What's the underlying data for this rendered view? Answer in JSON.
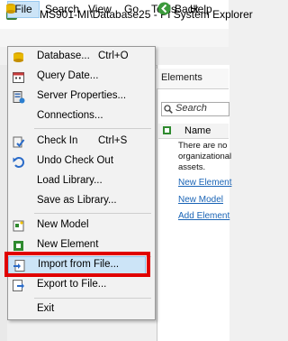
{
  "window": {
    "title": "\\\\PIMS901-MI\\Database25 - PI System Explorer"
  },
  "menubar": {
    "items": [
      "File",
      "Search",
      "View",
      "Go",
      "Tools",
      "Help"
    ]
  },
  "toolbar": {
    "back_label": "Back"
  },
  "elements_panel": {
    "title": "Elements",
    "search_placeholder": "Search",
    "column_name": "Name",
    "empty_message": "There are no organizational assets.",
    "links": [
      "New Element",
      "New Model",
      "Add Element"
    ]
  },
  "file_menu": {
    "items": [
      {
        "label": "Database...",
        "shortcut": "Ctrl+O",
        "icon": "database-icon"
      },
      {
        "label": "Query Date...",
        "shortcut": "",
        "icon": "calendar-icon"
      },
      {
        "label": "Server Properties...",
        "shortcut": "",
        "icon": "server-properties-icon"
      },
      {
        "label": "Connections...",
        "shortcut": "",
        "icon": ""
      },
      {
        "label": "Check In",
        "shortcut": "Ctrl+S",
        "icon": "check-in-icon"
      },
      {
        "label": "Undo Check Out",
        "shortcut": "",
        "icon": "undo-icon"
      },
      {
        "label": "Load Library...",
        "shortcut": "",
        "icon": ""
      },
      {
        "label": "Save as Library...",
        "shortcut": "",
        "icon": ""
      },
      {
        "label": "New Model",
        "shortcut": "",
        "icon": "new-model-icon"
      },
      {
        "label": "New Element",
        "shortcut": "",
        "icon": "new-element-icon"
      },
      {
        "label": "Import from File...",
        "shortcut": "",
        "icon": "import-icon"
      },
      {
        "label": "Export to File...",
        "shortcut": "",
        "icon": "export-icon"
      },
      {
        "label": "Exit",
        "shortcut": "",
        "icon": ""
      }
    ],
    "highlighted_item": "Import from File..."
  },
  "colors": {
    "highlight_border": "#e00000",
    "menu_hover": "#cce4f7",
    "link": "#1a64b6"
  }
}
